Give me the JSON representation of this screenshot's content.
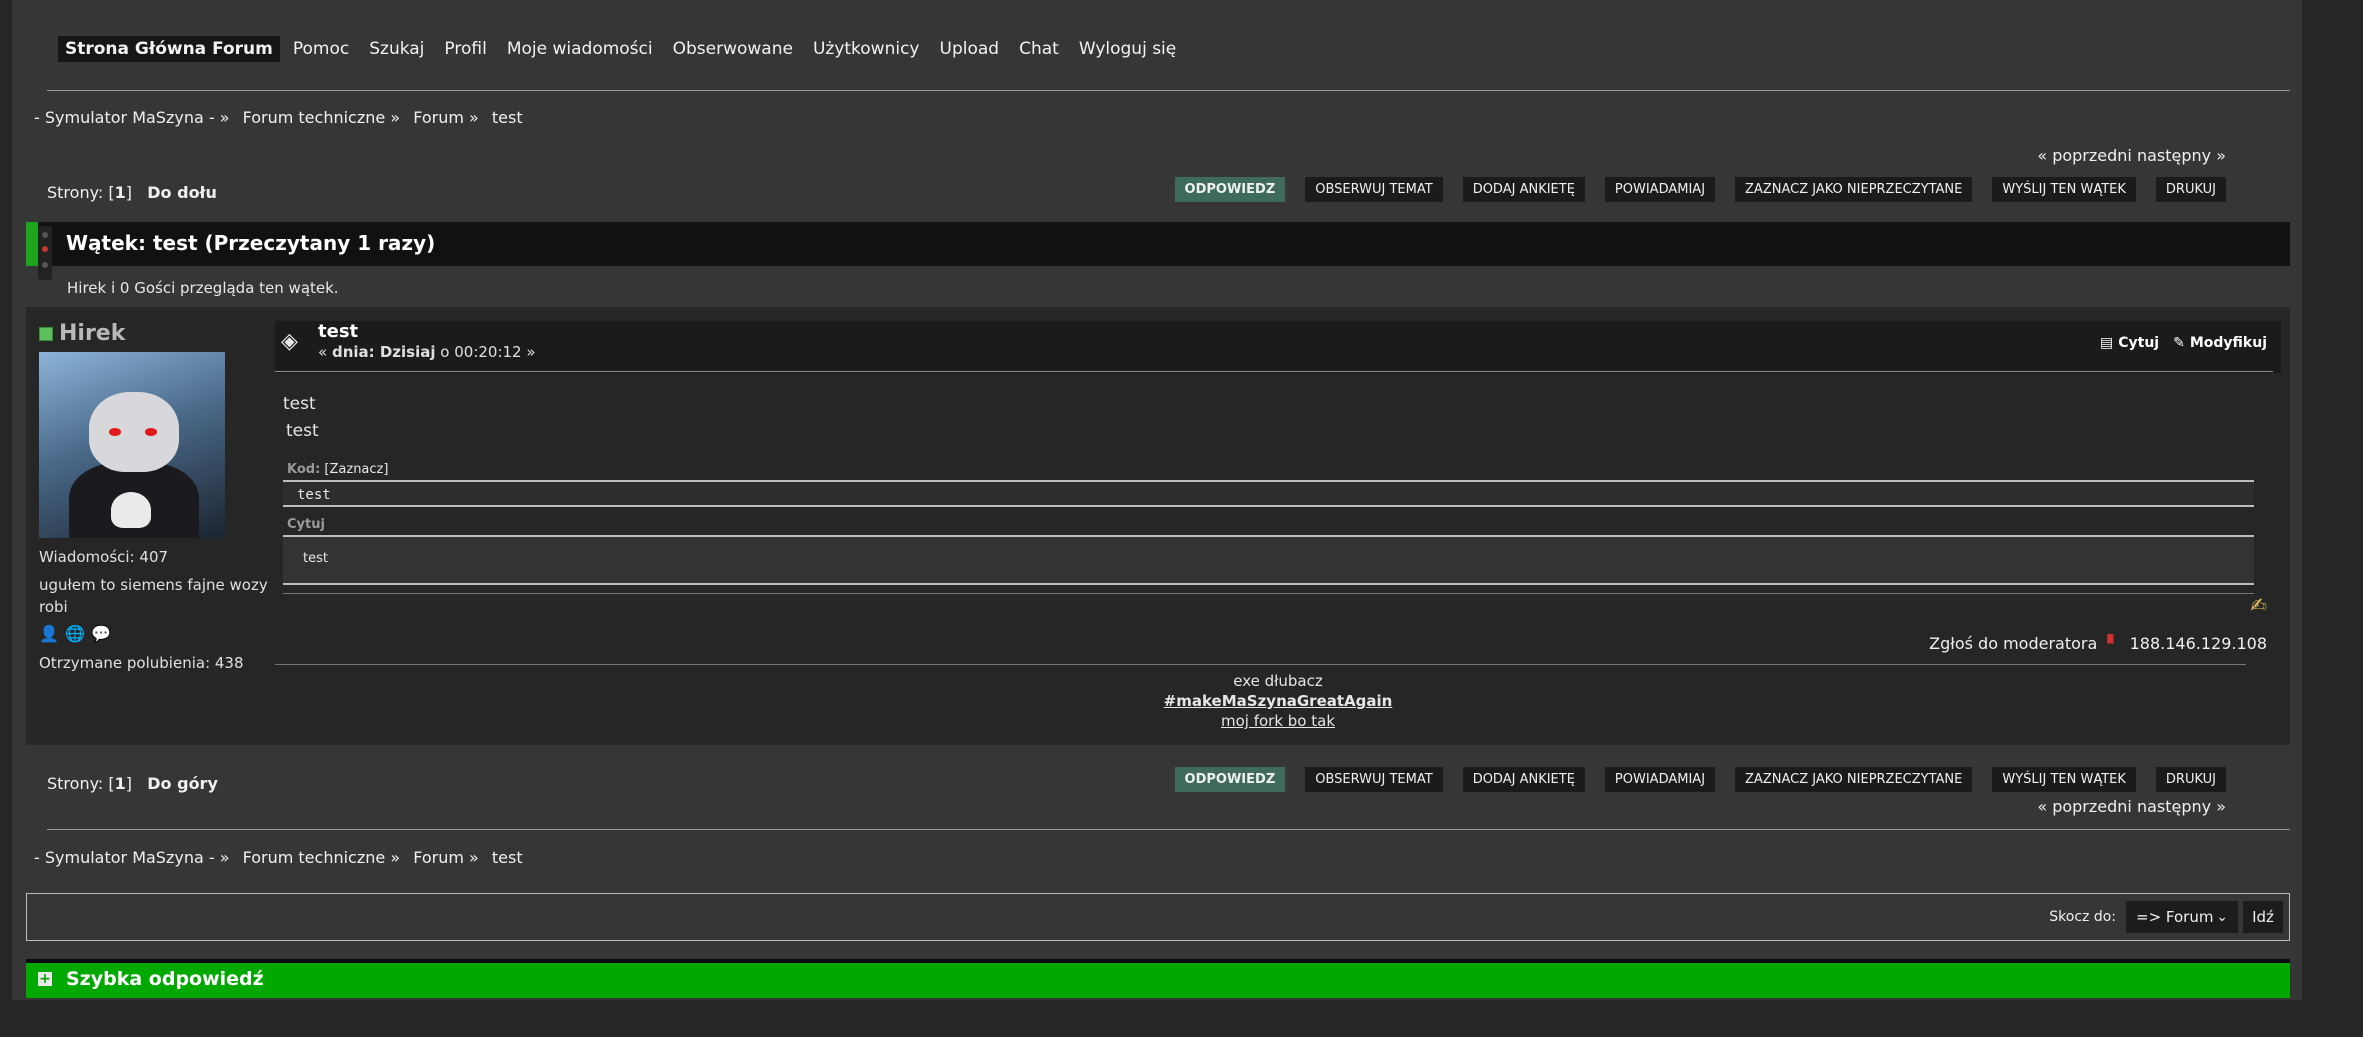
{
  "nav": {
    "items": [
      {
        "label": "Strona Główna Forum",
        "active": true
      },
      {
        "label": "Pomoc"
      },
      {
        "label": "Szukaj"
      },
      {
        "label": "Profil"
      },
      {
        "label": "Moje wiadomości"
      },
      {
        "label": "Obserwowane"
      },
      {
        "label": "Użytkownicy"
      },
      {
        "label": "Upload"
      },
      {
        "label": "Chat"
      },
      {
        "label": "Wyloguj się"
      }
    ]
  },
  "breadcrumb": {
    "items": [
      "- Symulator MaSzyna - »",
      "Forum techniczne »",
      "Forum »",
      "test"
    ]
  },
  "prevnext": "« poprzedni następny »",
  "pages": {
    "label": "Strony: [",
    "current": "1",
    "close": "]",
    "down": "Do dołu",
    "up": "Do góry"
  },
  "buttons": {
    "reply": "ODPOWIEDZ",
    "watch": "OBSERWUJ TEMAT",
    "poll": "DODAJ ANKIETĘ",
    "notify": "POWIADAMIAJ",
    "unread": "ZAZNACZ JAKO NIEPRZECZYTANE",
    "send": "WYŚLIJ TEN WĄTEK",
    "print": "DRUKUJ"
  },
  "thread": {
    "title": "Wątek:  test  (Przeczytany 1 razy)",
    "viewers": "Hirek i 0 Gości przegląda ten wątek."
  },
  "post": {
    "author": "Hirek",
    "messages": "Wiadomości: 407",
    "personal_text": "ugułem to siemens fajne wozy robi",
    "likes": "Otrzymane polubienia: 438",
    "title": "test",
    "date_prefix": "« ",
    "date_label": "dnia: Dzisiaj",
    "date_time": " o 00:20:12 »",
    "quote_action": "Cytuj",
    "modify_action": "Modyfikuj",
    "body_line1": "test",
    "body_line2": "test",
    "code_label": "Kod:",
    "code_select": "[Zaznacz]",
    "code_content": "test",
    "quote_label": "Cytuj",
    "quote_content": "test",
    "report": "Zgłoś do moderatora",
    "ip": "188.146.129.108",
    "sig_line1": "exe dłubacz",
    "sig_line2": "#makeMaSzynaGreatAgain",
    "sig_line3": "moj fork bo tak"
  },
  "jump": {
    "label": "Skocz do:",
    "selected": "=> Forum",
    "go": "Idź"
  },
  "quick_reply": "Szybka odpowiedź",
  "colors": {
    "accent_green": "#1ea51e",
    "quick_reply_green": "#00a800",
    "reply_button": "#3e6b5e"
  }
}
